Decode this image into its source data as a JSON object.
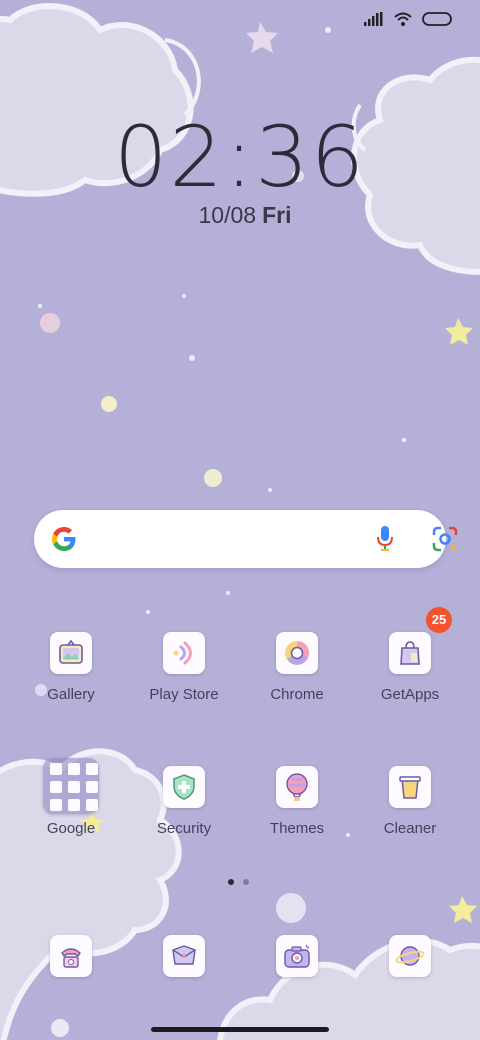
{
  "clock": {
    "time": "02:36"
  },
  "date": {
    "day": "10/08",
    "weekday": "Fri"
  },
  "status_bar": {
    "icons": [
      "signal-icon",
      "wifi-icon",
      "battery-icon"
    ]
  },
  "search": {
    "logo": "google-g-icon",
    "voice_icon": "mic-icon",
    "lens_icon": "lens-icon"
  },
  "apps_row1": [
    {
      "label": "Gallery",
      "icon": "gallery-icon"
    },
    {
      "label": "Play Store",
      "icon": "play-store-icon"
    },
    {
      "label": "Chrome",
      "icon": "chrome-icon"
    },
    {
      "label": "GetApps",
      "icon": "getapps-icon",
      "badge": "25"
    }
  ],
  "apps_row2": [
    {
      "label": "Google",
      "icon": "folder-icon"
    },
    {
      "label": "Security",
      "icon": "security-icon"
    },
    {
      "label": "Themes",
      "icon": "themes-icon"
    },
    {
      "label": "Cleaner",
      "icon": "cleaner-icon"
    }
  ],
  "dock": [
    {
      "icon": "phone-icon"
    },
    {
      "icon": "messages-icon"
    },
    {
      "icon": "camera-icon"
    },
    {
      "icon": "browser-icon"
    }
  ],
  "page_indicator": {
    "pages": 2,
    "current": 1
  },
  "colors": {
    "wallpaper": "#b5b0d8",
    "cloud": "#dcd8ea",
    "badge": "#f2542d",
    "accent": "#a56ad9"
  }
}
